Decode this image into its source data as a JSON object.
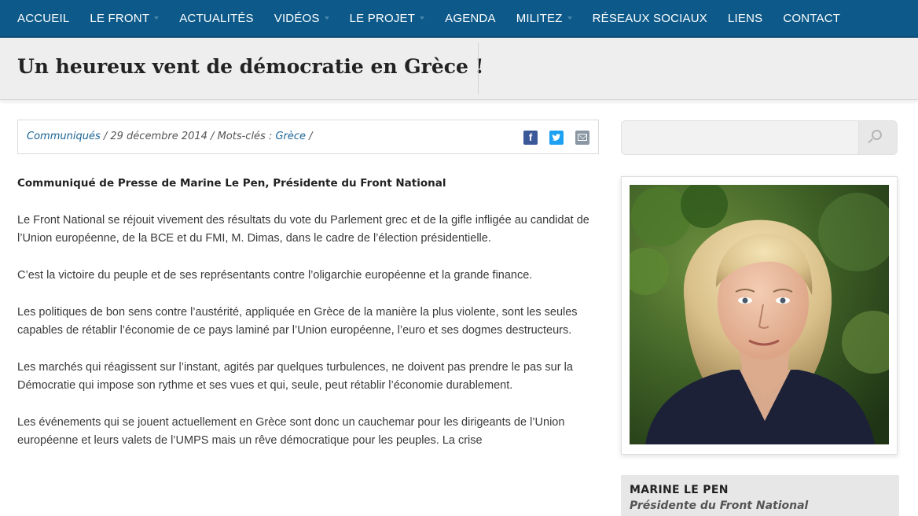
{
  "nav": {
    "items": [
      {
        "label": "ACCUEIL",
        "dropdown": false
      },
      {
        "label": "LE FRONT",
        "dropdown": true
      },
      {
        "label": "ACTUALITÉS",
        "dropdown": false
      },
      {
        "label": "VIDÉOS",
        "dropdown": true
      },
      {
        "label": "LE PROJET",
        "dropdown": true
      },
      {
        "label": "AGENDA",
        "dropdown": false
      },
      {
        "label": "MILITEZ",
        "dropdown": true
      },
      {
        "label": "RÉSEAUX SOCIAUX",
        "dropdown": false
      },
      {
        "label": "LIENS",
        "dropdown": false
      },
      {
        "label": "CONTACT",
        "dropdown": false
      }
    ]
  },
  "page": {
    "title": "Un heureux vent de démocratie en Grèce !"
  },
  "meta": {
    "category": "Communiqués",
    "sep1": " / ",
    "date": "29 décembre 2014",
    "sep2": " / Mots-clés : ",
    "tag": "Grèce",
    "sep3": " /"
  },
  "share": {
    "facebook_icon": "facebook-icon",
    "twitter_icon": "twitter-icon",
    "email_icon": "email-icon",
    "colors": {
      "facebook": "#3b5998",
      "twitter": "#1da1f2",
      "email": "#8a97a3"
    }
  },
  "article": {
    "lead": "Communiqué de Presse de Marine Le Pen, Présidente du Front National",
    "paragraphs": [
      "Le Front National se réjouit vivement des résultats du vote du Parlement grec et de la gifle infligée au candidat de l’Union européenne, de la BCE et du FMI, M. Dimas, dans le cadre de l’élection présidentielle.",
      "C’est la victoire du peuple et de ses représentants contre l’oligarchie européenne et la grande finance.",
      "Les politiques de bon sens contre l’austérité, appliquée en Grèce de la manière la plus violente, sont les seules capables de rétablir l’économie de ce pays laminé par l’Union européenne, l’euro et ses dogmes destructeurs.",
      "Les marchés qui réagissent sur l’instant, agités par quelques turbulences, ne doivent pas prendre le pas sur la Démocratie qui impose son rythme et ses vues et qui, seule, peut rétablir l’économie durablement.",
      "Les événements qui se jouent actuellement en Grèce sont donc un cauchemar pour les dirigeants de l’Union européenne et leurs valets de l’UMPS mais un rêve démocratique pour les peuples. La crise"
    ]
  },
  "search": {
    "placeholder": "",
    "icon": "search-icon"
  },
  "sidebar": {
    "name": "MARINE LE PEN",
    "role": "Présidente du Front National"
  },
  "colors": {
    "nav_bg": "#0d5a8a",
    "title_band": "#eeeeee",
    "link": "#1b6496"
  }
}
